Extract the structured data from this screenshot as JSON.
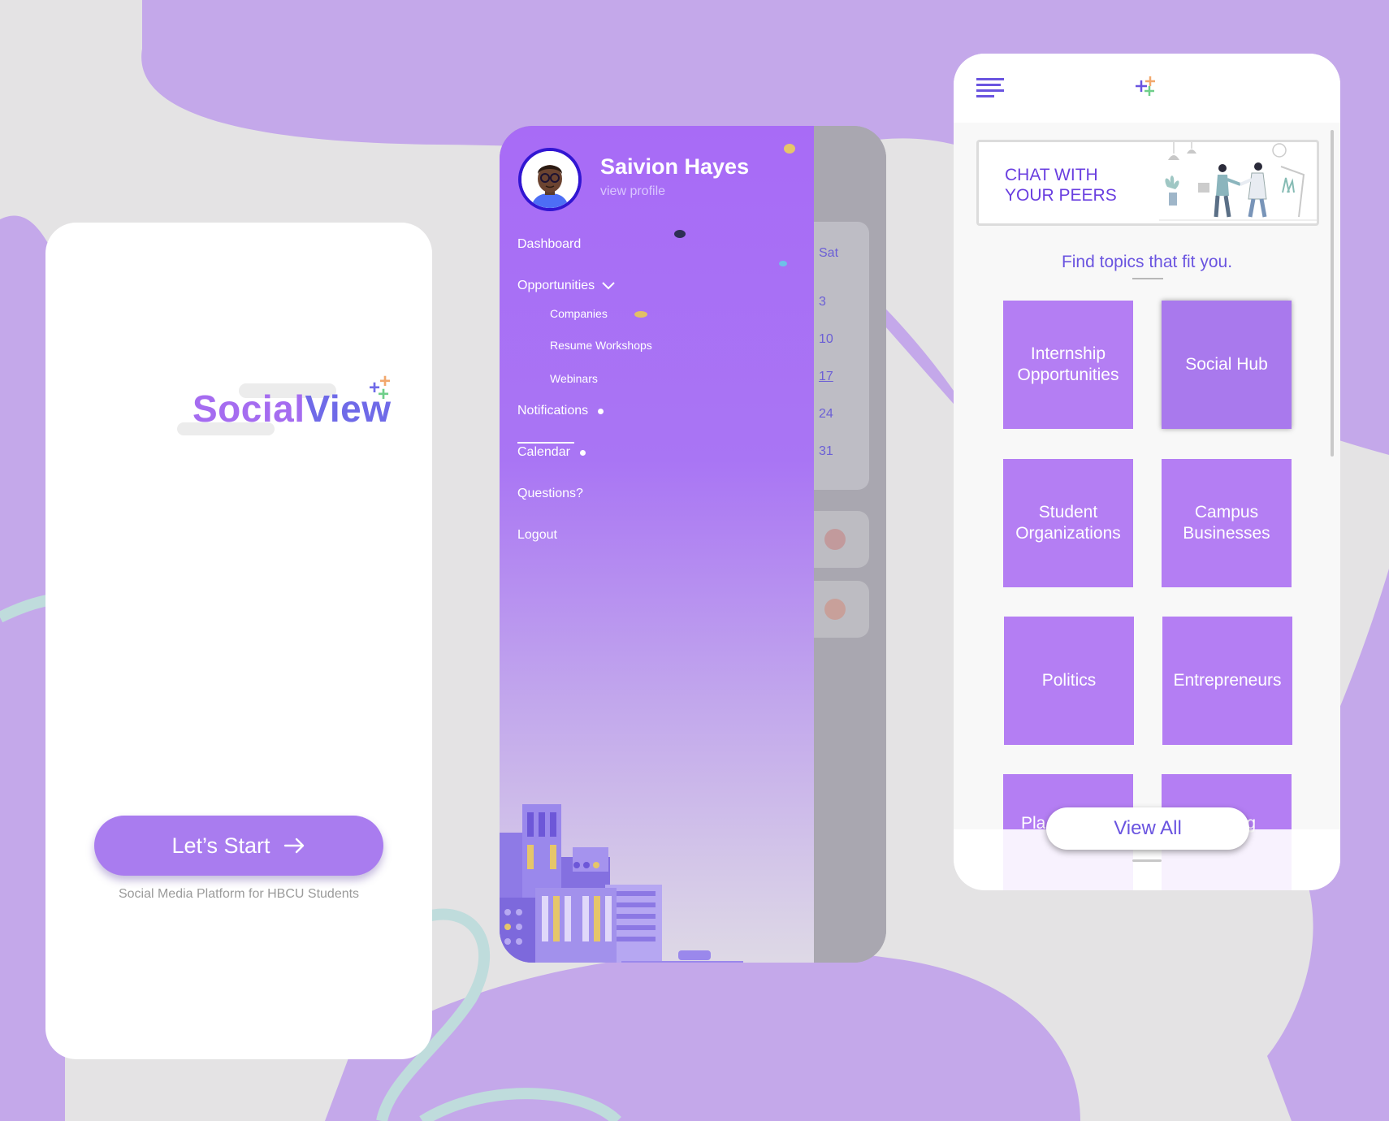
{
  "colors": {
    "background": "#e4e3e4",
    "blob": "#c4a8ea",
    "accent_purple": "#a97cef",
    "logo_purple": "#a56cf0",
    "logo_indigo": "#6f6ae8",
    "tile_purple": "#b47ef3",
    "text_indigo": "#6a54e0"
  },
  "splash": {
    "logo": {
      "part1": "Social",
      "part2": "View"
    },
    "start_button": {
      "label": "Let’s Start",
      "icon": "arrow-right-icon"
    },
    "tagline": "Social Media Platform for HBCU Students"
  },
  "drawer": {
    "user": {
      "name": "Saivion Hayes",
      "link": "view profile",
      "avatar_icon": "avatar-icon"
    },
    "nav": {
      "dashboard": "Dashboard",
      "opportunities": "Opportunities",
      "companies": "Companies",
      "resume_workshops": "Resume Workshops",
      "webinars": "Webinars",
      "notifications": "Notifications",
      "calendar": "Calendar",
      "questions": "Questions?",
      "logout": "Logout"
    },
    "calendar_peek": {
      "day_header": "Sat",
      "dates": [
        "3",
        "10",
        "17",
        "24",
        "31"
      ]
    }
  },
  "topics": {
    "header_icons": [
      "menu-icon",
      "logo-plus-icon"
    ],
    "banner": {
      "text": "CHAT WITH\nYOUR PEERS"
    },
    "title": "Find topics that fit you.",
    "tiles": [
      "Internship Opportunities",
      "Social Hub",
      "Student Organizations",
      "Campus Businesses",
      "Politics",
      "Entrepreneurs",
      "Pla",
      "g"
    ],
    "selected_tile": "Social Hub",
    "view_all": "View All"
  }
}
